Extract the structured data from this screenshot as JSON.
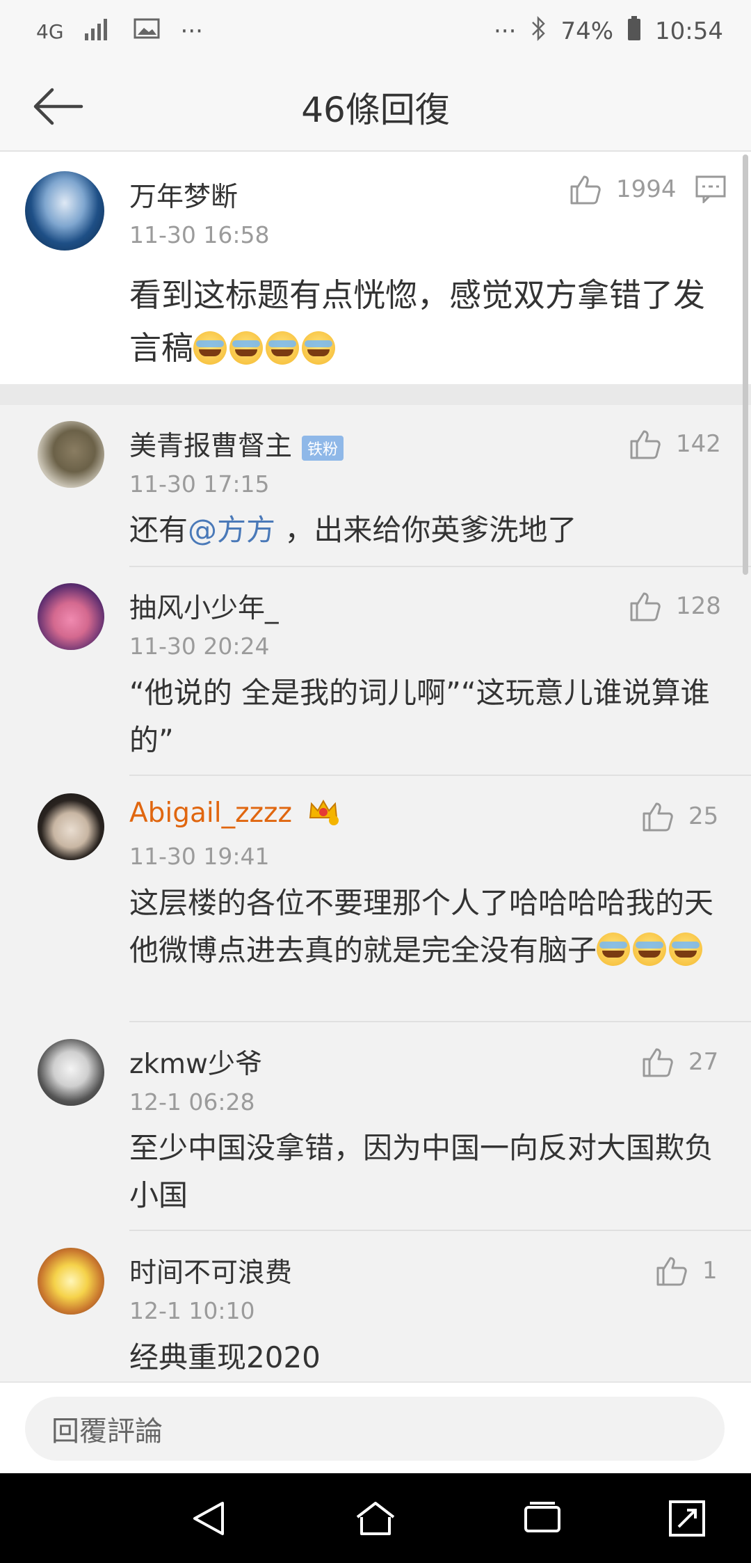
{
  "status_bar": {
    "network": "4G",
    "ellipsis_left": "···",
    "ellipsis_right": "···",
    "battery": "74%",
    "time": "10:54"
  },
  "nav": {
    "title": "46條回復"
  },
  "main_comment": {
    "user": "万年梦断",
    "time": "11-30 16:58",
    "likes": "1994",
    "text": "看到这标题有点恍惚，感觉双方拿错了发言稿"
  },
  "replies": [
    {
      "user": "美青报曹督主",
      "badge": "铁粉",
      "time": "11-30 17:15",
      "likes": "142",
      "text_before": "还有",
      "mention": "@方方",
      "text_after": " ，出来给你英爹洗地了"
    },
    {
      "user": "抽风小少年_",
      "time": "11-30 20:24",
      "likes": "128",
      "text": "“他说的 全是我的词儿啊”“这玩意儿谁说算谁的”"
    },
    {
      "user": "Abigail_zzzz",
      "time": "11-30 19:41",
      "likes": "25",
      "text": "这层楼的各位不要理那个人了哈哈哈哈我的天他微博点进去真的就是完全没有脑子"
    },
    {
      "user": "zkmw少爷",
      "time": "12-1 06:28",
      "likes": "27",
      "text": "至少中国没拿错，因为中国一向反对大国欺负小国"
    },
    {
      "user": "时间不可浪费",
      "time": "12-1 10:10",
      "likes": "1",
      "text": "经典重现2020"
    }
  ],
  "reply_box": {
    "placeholder": "回覆評論"
  },
  "colors": {
    "vip_name": "#e0660f",
    "mention": "#4a79b8",
    "badge": "#8fb8e8"
  }
}
